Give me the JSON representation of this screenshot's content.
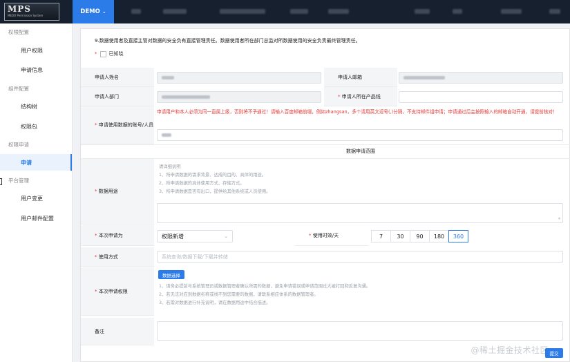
{
  "app": {
    "logo_title": "MPS",
    "logo_subtitle": "MEDO Permission System",
    "env_label": "DEMO"
  },
  "sidebar": {
    "groups": [
      {
        "label": "权限配置",
        "items": [
          {
            "label": "用户权限"
          },
          {
            "label": "申请信息"
          }
        ]
      },
      {
        "label": "组件配置",
        "items": [
          {
            "label": "结构树"
          },
          {
            "label": "权限包"
          }
        ]
      },
      {
        "label": "权限申请",
        "items": [
          {
            "label": "申请",
            "active": true
          }
        ]
      },
      {
        "label": "平台管理",
        "items": [
          {
            "label": "用户变更"
          },
          {
            "label": "用户邮件配置"
          }
        ]
      }
    ]
  },
  "form": {
    "notice": "9.数据使用者及直接主管对数据的安全负有直接管理责任。数据使用者所在部门总监对所数据使用的安全负责最终管理责任。",
    "ack_label": "已知晓",
    "applicant_name_label": "申请人姓名",
    "applicant_email_label": "申请人邮箱",
    "applicant_dept_label": "申请人部门",
    "product_line_label": "申请人所在产品线",
    "account_label": "申请使用数据的账号/人员",
    "account_warning": "申请用户和本人必须为同一直属上级，否则将不予通过！请输入百度邮箱前缀，例如zhangsan，多个请用英文逗号(,)分隔，不支持邮件组申请；申请通过后会按照输入的邮箱自动开通，请提前核对！",
    "scope_title": "数据申请范围",
    "purpose_label": "数据用途",
    "purpose_hints": [
      "请详细说明",
      "1、所申请数据的需求背景、达成的目的、具体的用途。",
      "2、所申请数据的具体使用方式、存储方式。",
      "3、所申请数据是否有出口，提供给其他系统或人员使用。"
    ],
    "apply_type_label": "本次申请为",
    "apply_type_value": "权限新增",
    "duration_label": "使用时效/天",
    "duration_options": [
      "7",
      "30",
      "90",
      "180",
      "360"
    ],
    "duration_selected": "360",
    "usage_label": "使用方式",
    "usage_placeholder": "系统查询/数据下载/下载并转储",
    "permission_label": "本次申请权限",
    "data_select_button": "数据选择",
    "permission_hints": [
      "1、请务必提前与系统管理员或数据管理者确认所需的数据，避免申请错误或申请范围过大被打回和反复沟通。",
      "2、若无法对应到数据名称或找不到您需要的数据，请联系相应体系的数据管理者。",
      "3、若需对数据进行补充说明，请在数据用途中结合描述。"
    ],
    "remark_label": "备注",
    "submit_label": "提交"
  },
  "watermark": "@稀土掘金技术社区"
}
